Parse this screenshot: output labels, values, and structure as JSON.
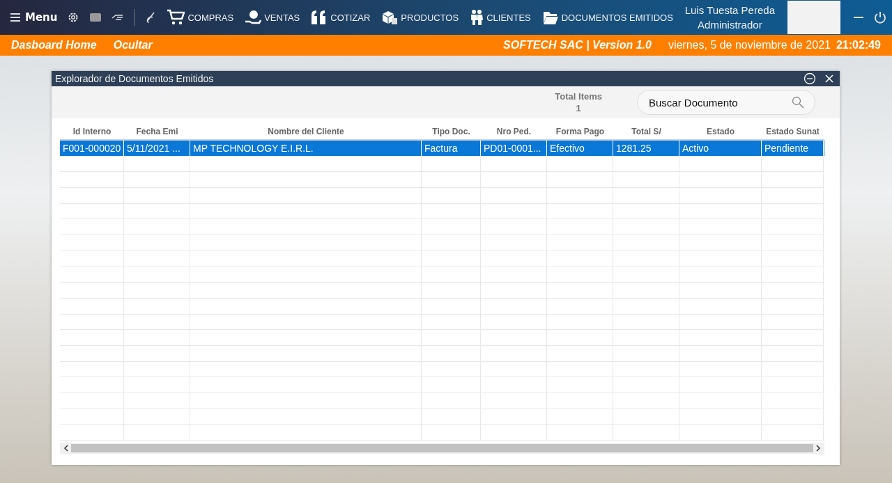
{
  "topbar": {
    "menu_label": "Menu",
    "nav": [
      {
        "label": "COMPRAS",
        "kind": "cart"
      },
      {
        "label": "VENTAS",
        "kind": "money"
      },
      {
        "label": "COTIZAR",
        "kind": "quote"
      },
      {
        "label": "PRODUCTOS",
        "kind": "boxes"
      },
      {
        "label": "CLIENTES",
        "kind": "people"
      },
      {
        "label": "DOCUMENTOS EMITIDOS",
        "kind": "folder"
      }
    ],
    "user": {
      "name": "Luis Tuesta Pereda",
      "role": "Administrador"
    }
  },
  "subbar": {
    "links": [
      "Dasboard Home",
      "Ocultar"
    ],
    "company": "SOFTECH SAC | Version 1.0",
    "date": "viernes, 5 de noviembre de 2021",
    "time": "21:02:49"
  },
  "dialog": {
    "title": "Explorador de Documentos Emitidos",
    "total_label": "Total Items",
    "total_value": "1",
    "search": {
      "placeholder": "Buscar Documento"
    },
    "table": {
      "columns": [
        "Id Interno",
        "Fecha Emi",
        "Nombre del Cliente",
        "Tipo Doc.",
        "Nro Ped.",
        "Forma Pago",
        "Total S/",
        "Estado",
        "Estado Sunat"
      ],
      "rows": [
        {
          "cells": [
            "F001-000020",
            "5/11/2021 ...",
            "MP TECHNOLOGY E.I.R.L.",
            "Factura",
            "PD01-0001...",
            "Efectivo",
            "1281.25",
            "Activo",
            "Pendiente"
          ],
          "selected": true
        }
      ]
    }
  }
}
